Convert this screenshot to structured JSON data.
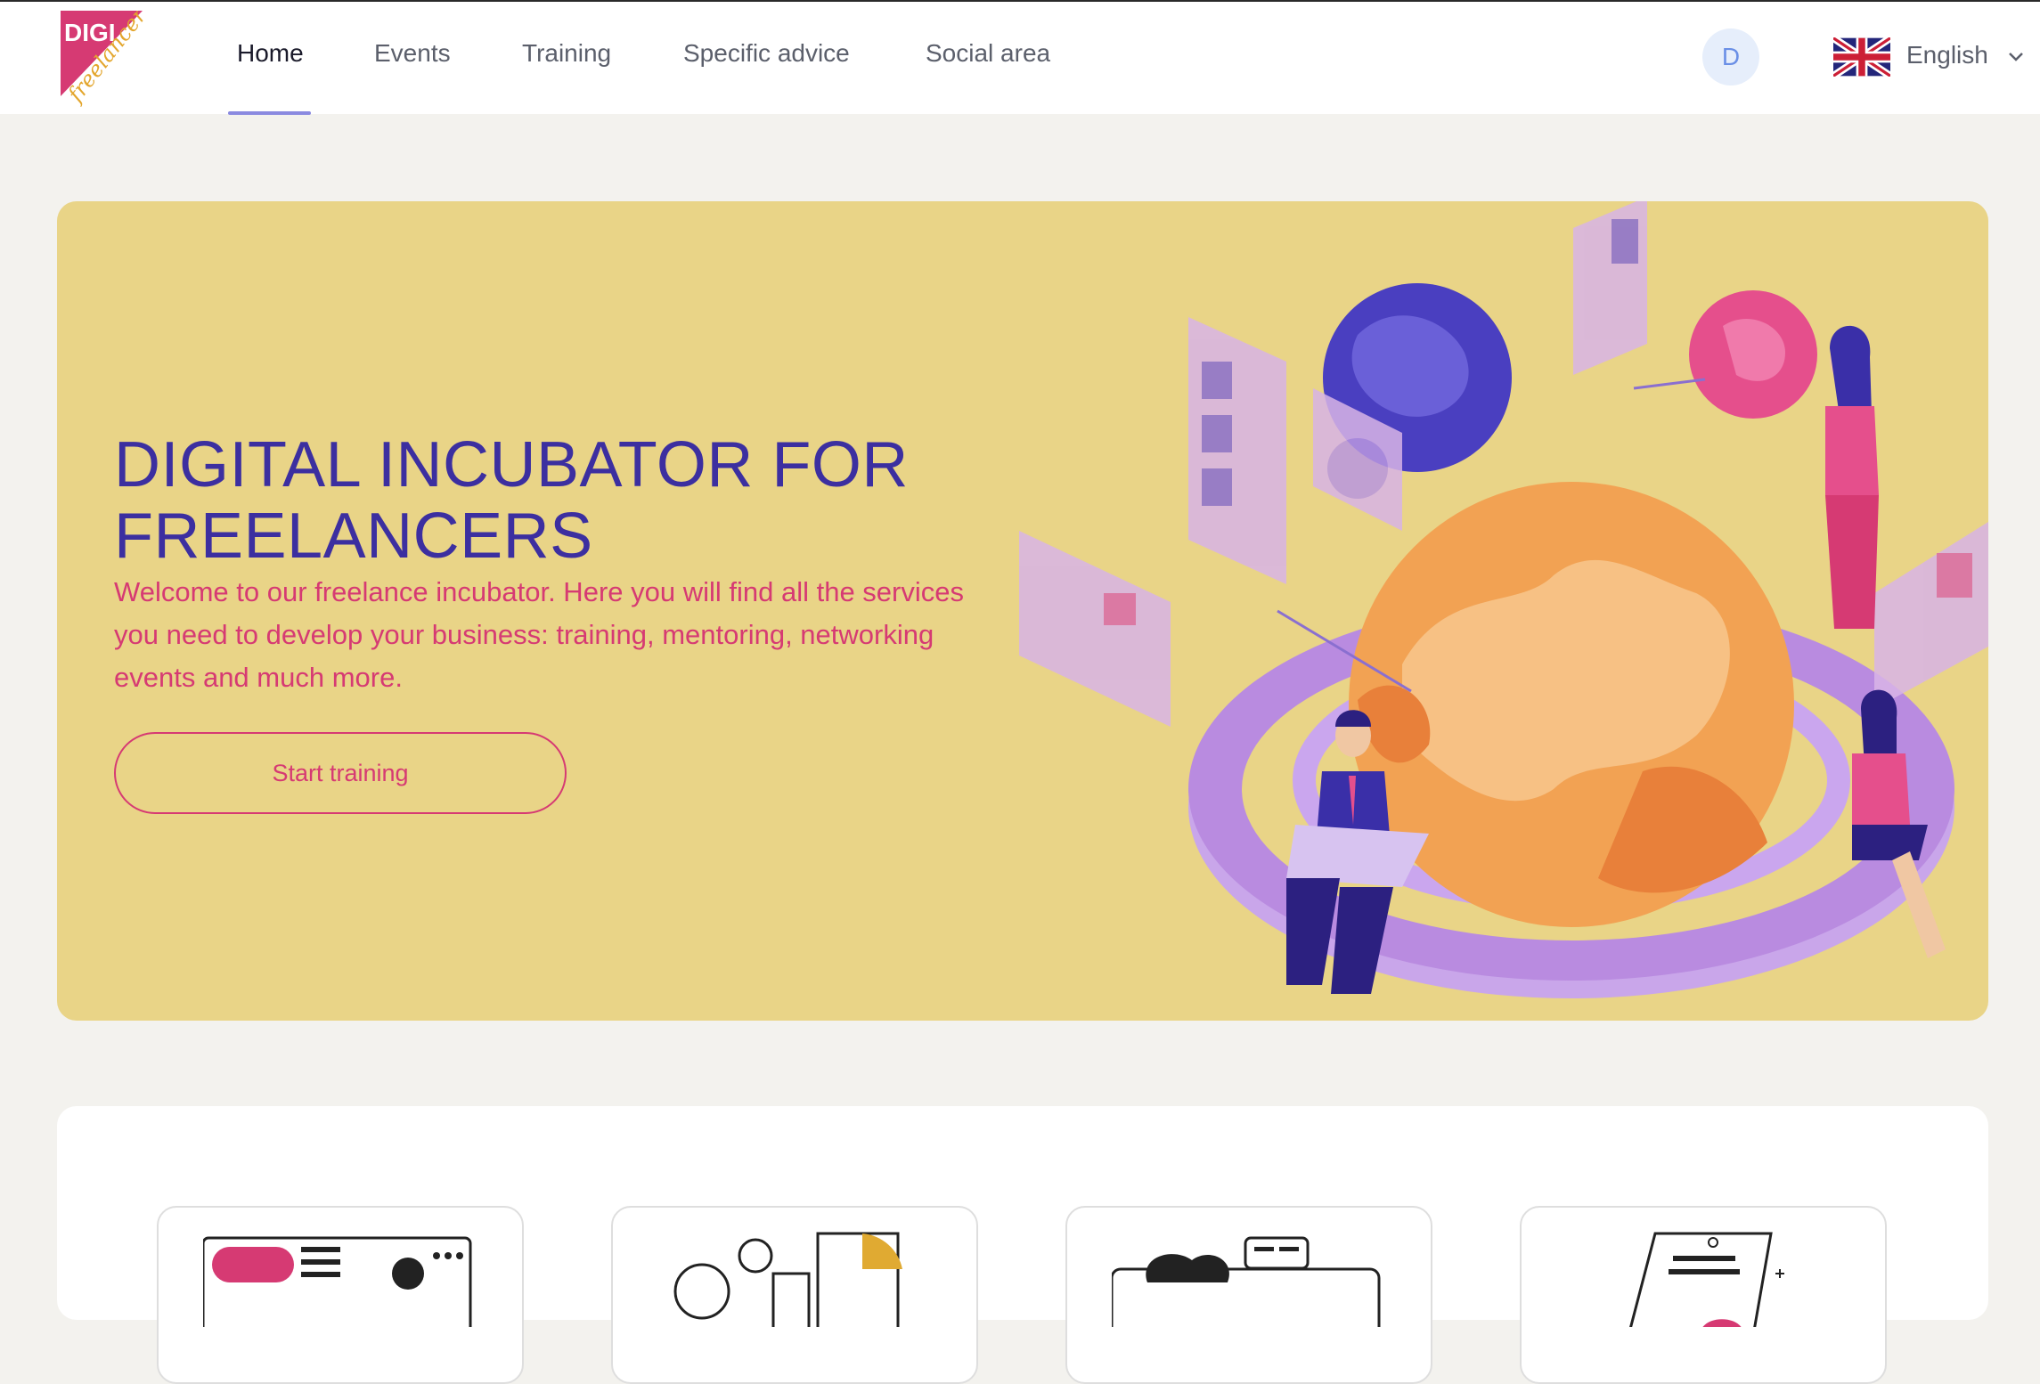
{
  "brand": {
    "logo_text_top": "DIGI",
    "logo_text_bottom": "freelancer",
    "colors": {
      "pink": "#d63a73",
      "purple": "#3c2fa0",
      "yellow": "#e9d487"
    }
  },
  "nav": {
    "items": [
      {
        "label": "Home",
        "active": true
      },
      {
        "label": "Events",
        "active": false
      },
      {
        "label": "Training",
        "active": false
      },
      {
        "label": "Specific advice",
        "active": false
      },
      {
        "label": "Social area",
        "active": false
      }
    ]
  },
  "user": {
    "avatar_initial": "D"
  },
  "language": {
    "selected": "English",
    "flag_icon": "uk-flag-icon"
  },
  "hero": {
    "title": "DIGITAL INCUBATOR FOR FREELANCERS",
    "description": "Welcome to our freelance incubator. Here you will find all the services you need to develop your business: training, mentoring, networking events and much more.",
    "cta_label": "Start training",
    "illustration": "globe-network-illustration"
  },
  "feature_cards": [
    {
      "icon": "web-page-illustration"
    },
    {
      "icon": "analytics-gears-illustration"
    },
    {
      "icon": "chat-community-illustration"
    },
    {
      "icon": "mobile-device-illustration"
    }
  ]
}
